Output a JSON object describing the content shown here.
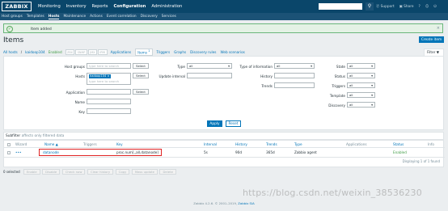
{
  "app": {
    "logo": "ZABBIX",
    "top_nav": [
      "Monitoring",
      "Inventory",
      "Reports",
      "Configuration",
      "Administration"
    ],
    "top_nav_active": "Configuration",
    "top_right": {
      "support": "Support",
      "share": "Share",
      "help": "?"
    },
    "sub_nav": [
      "Host groups",
      "Templates",
      "Hosts",
      "Maintenance",
      "Actions",
      "Event correlation",
      "Discovery",
      "Services"
    ],
    "sub_nav_active": "Hosts"
  },
  "message": {
    "text": "Item added"
  },
  "page": {
    "title": "Items",
    "create_button": "Create item"
  },
  "host_tabs": {
    "all_hosts": "All hosts",
    "separator": "/",
    "host": "kaidoop104",
    "status": "Enabled",
    "badges": [
      "ZBX",
      "SNMP",
      "JMX",
      "IPMI"
    ],
    "applications": "Applications",
    "items": "Items",
    "items_count": "1",
    "triggers": "Triggers",
    "graphs": "Graphs",
    "discovery": "Discovery rules",
    "web": "Web scenarios",
    "filter": "Filter"
  },
  "filter": {
    "host_groups_label": "Host groups",
    "host_groups_placeholder": "type here to search",
    "hosts_label": "Hosts",
    "hosts_chip": "hadoop104",
    "hosts_placeholder": "type here to search",
    "application_label": "Application",
    "name_label": "Name",
    "key_label": "Key",
    "select": "Select",
    "type_label": "Type",
    "type_value": "all",
    "update_interval_label": "Update interval",
    "type_info_label": "Type of information",
    "type_info_value": "all",
    "history_label": "History",
    "trends_label": "Trends",
    "state_label": "State",
    "state_value": "all",
    "status_label": "Status",
    "status_value": "all",
    "triggers_label": "Triggers",
    "triggers_value": "all",
    "template_label": "Template",
    "template_value": "all",
    "discovery_label": "Discovery",
    "discovery_value": "all",
    "apply": "Apply",
    "reset": "Reset"
  },
  "subfilter": {
    "label": "Subfilter",
    "hint": "affects only filtered data"
  },
  "table": {
    "headers": {
      "wizard": "Wizard",
      "name": "Name ▲",
      "triggers": "Triggers",
      "key": "Key",
      "interval": "Interval",
      "history": "History",
      "trends": "Trends",
      "type": "Type",
      "applications": "Applications",
      "status": "Status",
      "info": "Info"
    },
    "rows": [
      {
        "wizard": "•••",
        "name": "datanode",
        "triggers": "",
        "key": "proc.num[,,all,datanode]",
        "interval": "5s",
        "history": "90d",
        "trends": "365d",
        "type": "Zabbix agent",
        "applications": "",
        "status": "Enabled"
      }
    ],
    "displaying": "Displaying 1 of 1 found"
  },
  "mass": {
    "selected": "0 selected",
    "buttons": [
      "Enable",
      "Disable",
      "Check now",
      "Clear history",
      "Copy",
      "Mass update",
      "Delete"
    ]
  },
  "footer": {
    "text": "Zabbix 4.2.6. © 2001–2019,",
    "link": "Zabbix SIA"
  },
  "watermark": "https://blog.csdn.net/weixin_38536230",
  "colors": {
    "header": "#0a466a",
    "subnav": "#1b5276",
    "accent": "#0275b8",
    "ok": "#429e47",
    "highlight": "#e02424"
  }
}
